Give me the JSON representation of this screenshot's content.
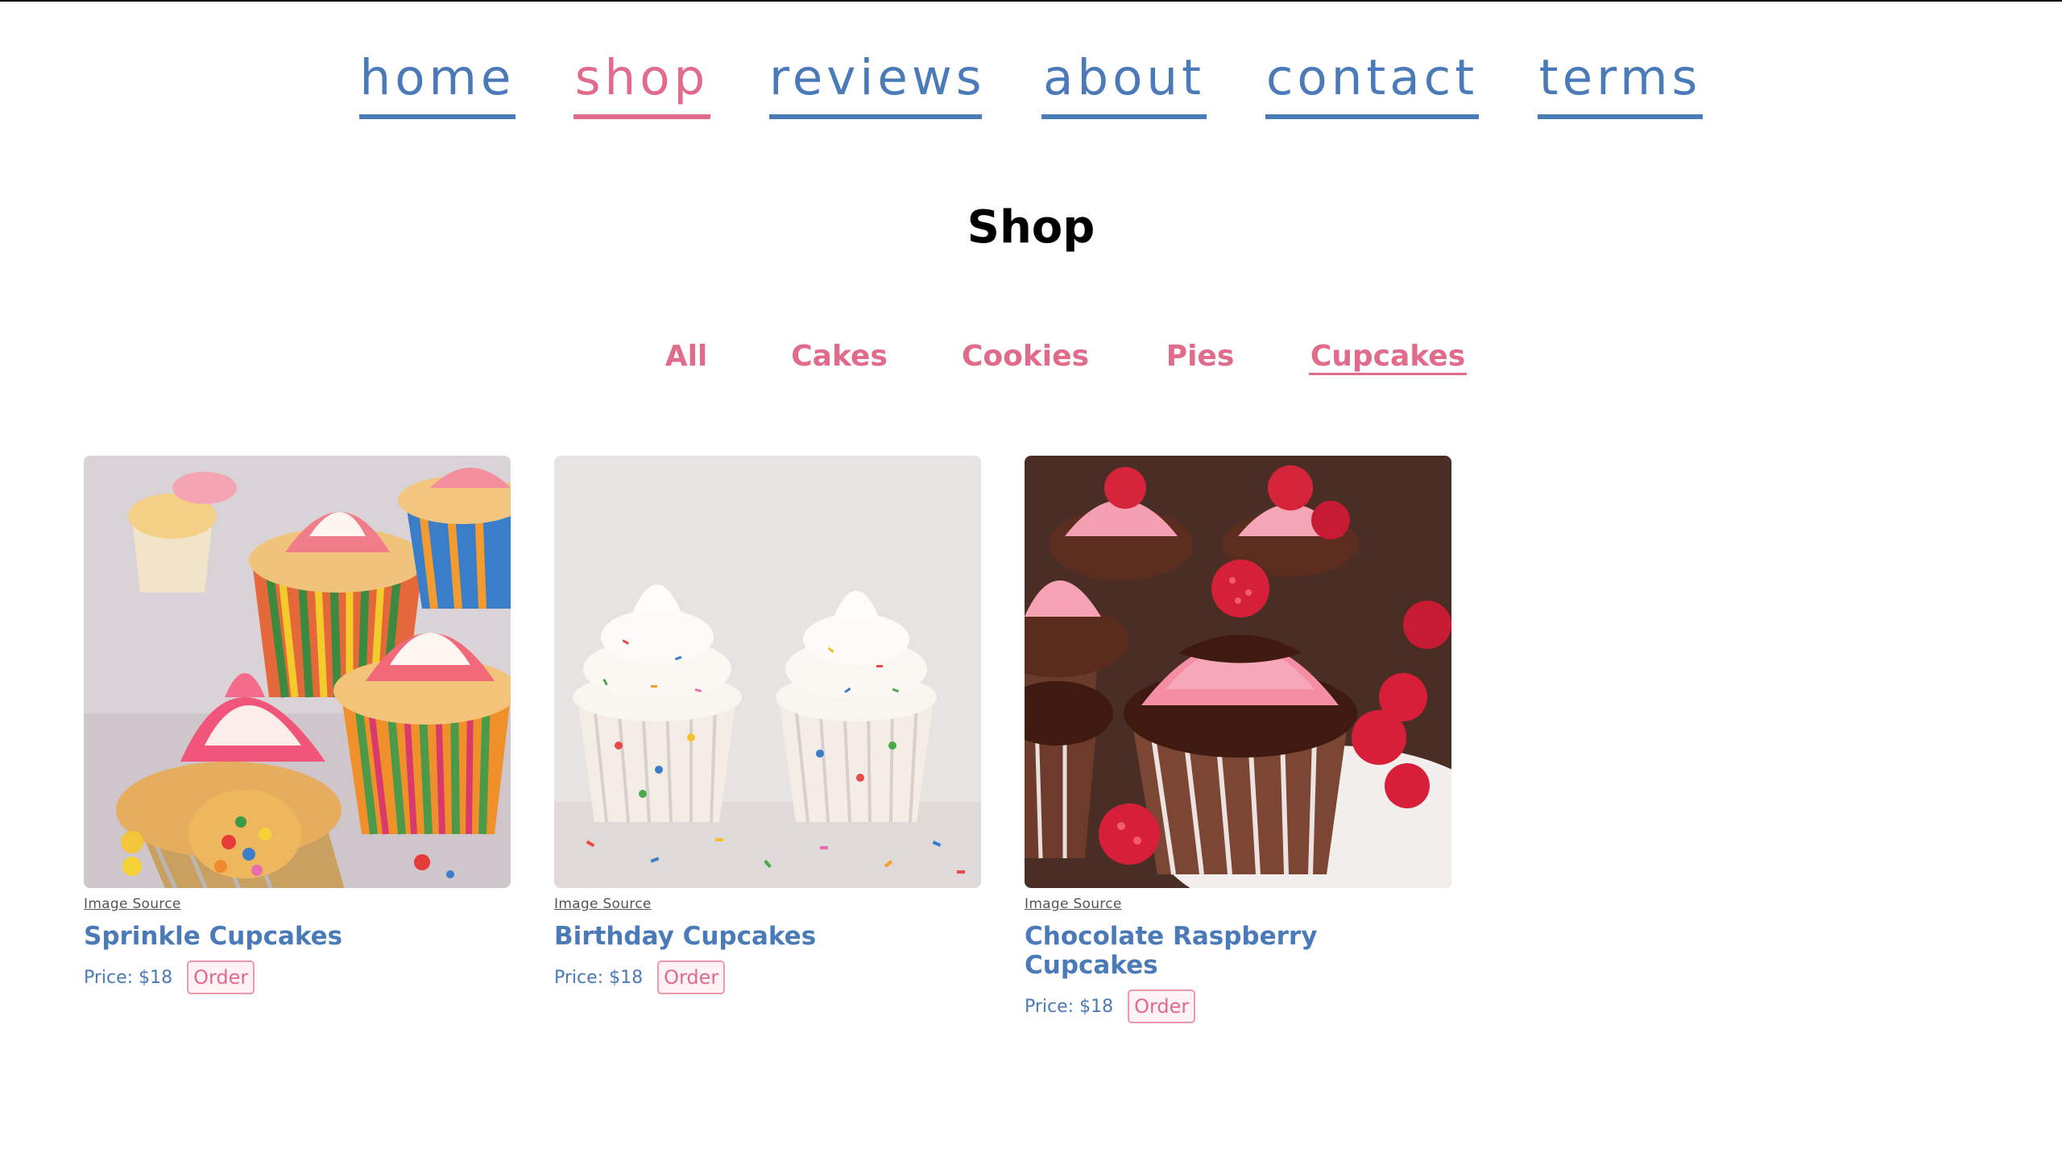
{
  "nav": {
    "items": [
      {
        "label": "home",
        "active": false
      },
      {
        "label": "shop",
        "active": true
      },
      {
        "label": "reviews",
        "active": false
      },
      {
        "label": "about",
        "active": false
      },
      {
        "label": "contact",
        "active": false
      },
      {
        "label": "terms",
        "active": false
      }
    ]
  },
  "page_title": "Shop",
  "filters": {
    "items": [
      {
        "label": "All",
        "active": false
      },
      {
        "label": "Cakes",
        "active": false
      },
      {
        "label": "Cookies",
        "active": false
      },
      {
        "label": "Pies",
        "active": false
      },
      {
        "label": "Cupcakes",
        "active": true
      }
    ]
  },
  "products": [
    {
      "name": "Sprinkle Cupcakes",
      "source_label": "Image Source",
      "price_text": "Price: $18",
      "order_label": "Order"
    },
    {
      "name": "Birthday Cupcakes",
      "source_label": "Image Source",
      "price_text": "Price: $18",
      "order_label": "Order"
    },
    {
      "name": "Chocolate Raspberry Cupcakes",
      "source_label": "Image Source",
      "price_text": "Price: $18",
      "order_label": "Order"
    }
  ],
  "colors": {
    "nav_blue": "#4a7ab8",
    "accent_pink": "#e06b8a"
  }
}
